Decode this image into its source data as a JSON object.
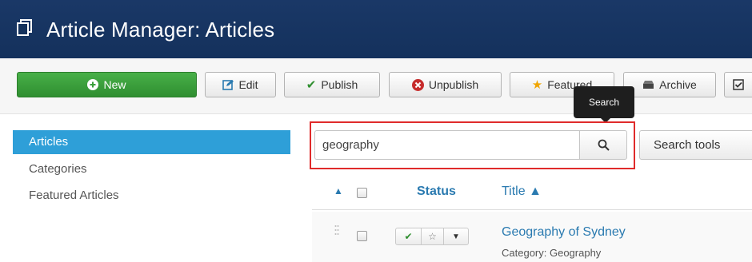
{
  "header": {
    "title": "Article Manager: Articles",
    "icon": "copy-icon",
    "background_color": "#14315c"
  },
  "toolbar": {
    "buttons": [
      {
        "label": "New",
        "icon": "plus-circle-icon",
        "color": "#3a9f3a"
      },
      {
        "label": "Edit",
        "icon": "edit-icon"
      },
      {
        "label": "Publish",
        "icon": "check-icon"
      },
      {
        "label": "Unpublish",
        "icon": "x-circle-icon"
      },
      {
        "label": "Featured",
        "icon": "star-icon"
      },
      {
        "label": "Archive",
        "icon": "archive-icon"
      },
      {
        "label": "",
        "icon": "checkbox-icon"
      }
    ]
  },
  "tooltip": {
    "text": "Search"
  },
  "sidebar": {
    "items": [
      {
        "label": "Articles",
        "active": true
      },
      {
        "label": "Categories",
        "active": false
      },
      {
        "label": "Featured Articles",
        "active": false
      }
    ],
    "active_color": "#2e9fd8"
  },
  "search": {
    "value": "geography",
    "button_icon": "search-icon",
    "tools_label": "Search tools",
    "highlight_color": "#e02b2b"
  },
  "table": {
    "headers": {
      "status": "Status",
      "title": "Title ▲"
    },
    "rows": [
      {
        "title": "Geography of Sydney",
        "category": "Category: Geography",
        "published": true,
        "featured": false
      }
    ]
  }
}
